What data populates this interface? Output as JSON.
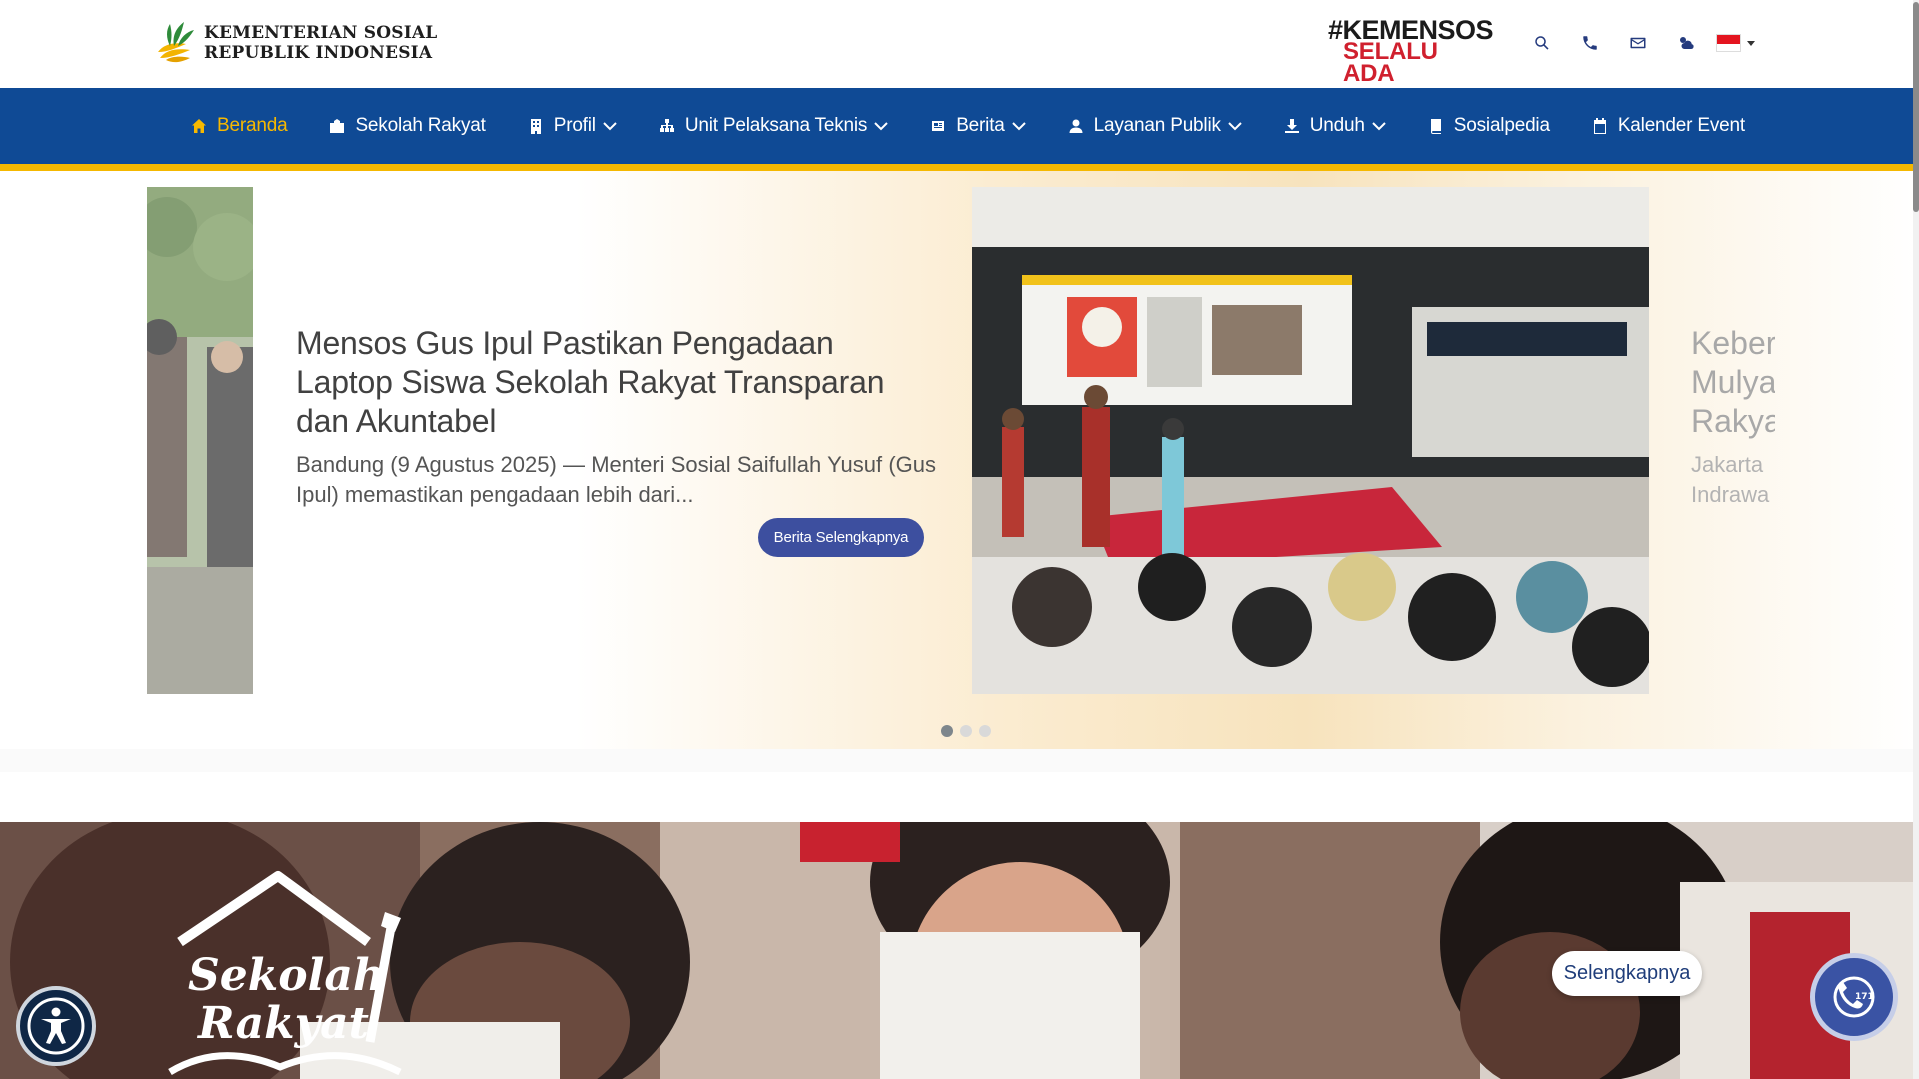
{
  "header": {
    "logo_line1": "KEMENTERIAN SOSIAL",
    "logo_line2": "REPUBLIK INDONESIA",
    "tagline_line1": "#KEMENSOS",
    "tagline_line2": "SELALU ADA",
    "icons": [
      "search-icon",
      "phone-icon",
      "mail-icon",
      "weather-icon"
    ],
    "language_flag": "indonesia-flag"
  },
  "nav": {
    "items": [
      {
        "label": "Beranda",
        "icon": "home-icon",
        "dropdown": false,
        "active": true
      },
      {
        "label": "Sekolah Rakyat",
        "icon": "school-icon",
        "dropdown": false
      },
      {
        "label": "Profil",
        "icon": "building-icon",
        "dropdown": true
      },
      {
        "label": "Unit Pelaksana Teknis",
        "icon": "sitemap-icon",
        "dropdown": true
      },
      {
        "label": "Berita",
        "icon": "newspaper-icon",
        "dropdown": true
      },
      {
        "label": "Layanan Publik",
        "icon": "user-icon",
        "dropdown": true
      },
      {
        "label": "Unduh",
        "icon": "download-icon",
        "dropdown": true
      },
      {
        "label": "Sosialpedia",
        "icon": "book-icon",
        "dropdown": false
      },
      {
        "label": "Kalender Event",
        "icon": "calendar-icon",
        "dropdown": false
      }
    ],
    "colors": {
      "bg": "#0f4a95",
      "active": "#f7b800",
      "underline": "#f5b800"
    }
  },
  "slider": {
    "title": "Mensos Gus Ipul Pastikan Pengadaan Laptop Siswa Sekolah Rakyat Transparan dan Akuntabel",
    "excerpt": "Bandung (9 Agustus 2025) — Menteri Sosial Saifullah Yusuf (Gus Ipul) memastikan pengadaan lebih dari...",
    "button": "Berita Selengkapnya",
    "next_title_lines": [
      "Keber",
      "Mulya",
      "Rakya"
    ],
    "next_text_lines": [
      "Jakarta",
      "Indrawa"
    ],
    "dots": 3,
    "active_dot": 0,
    "button_color": "#3d4f9f"
  },
  "banner": {
    "logo_line1": "Sekolah",
    "logo_line2": "Rakyat",
    "button": "Selengkapnya"
  },
  "widgets": {
    "accessibility_icon": "accessibility-icon",
    "help_icon": "call-center-icon",
    "help_number": "171"
  }
}
